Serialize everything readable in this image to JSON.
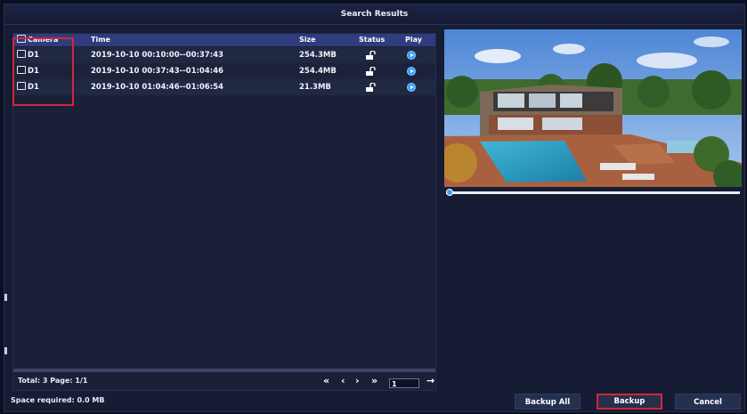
{
  "title": "Search Results",
  "table": {
    "headers": {
      "camera": "Camera",
      "time": "Time",
      "size": "Size",
      "status": "Status",
      "play": "Play"
    },
    "rows": [
      {
        "camera": "D1",
        "time": "2019-10-10 00:10:00--00:37:43",
        "size": "254.3MB",
        "status_icon": "unlock-icon",
        "play_icon": "play-icon"
      },
      {
        "camera": "D1",
        "time": "2019-10-10 00:37:43--01:04:46",
        "size": "254.4MB",
        "status_icon": "unlock-icon",
        "play_icon": "play-icon"
      },
      {
        "camera": "D1",
        "time": "2019-10-10 01:04:46--01:06:54",
        "size": "21.3MB",
        "status_icon": "unlock-icon",
        "play_icon": "play-icon"
      }
    ]
  },
  "pagination": {
    "total_label": "Total: 3  Page: 1/1",
    "first": "«",
    "prev": "‹",
    "next": "›",
    "last": "»",
    "page_value": "1",
    "go": "→"
  },
  "preview": {
    "progress": 0.0
  },
  "footer": {
    "space_required": "Space required: 0.0 MB",
    "backup_all": "Backup All",
    "backup": "Backup",
    "cancel": "Cancel"
  },
  "colors": {
    "header_bg": "#2f3c7d",
    "accent": "#3aa0ff",
    "highlight": "#d2263a"
  }
}
